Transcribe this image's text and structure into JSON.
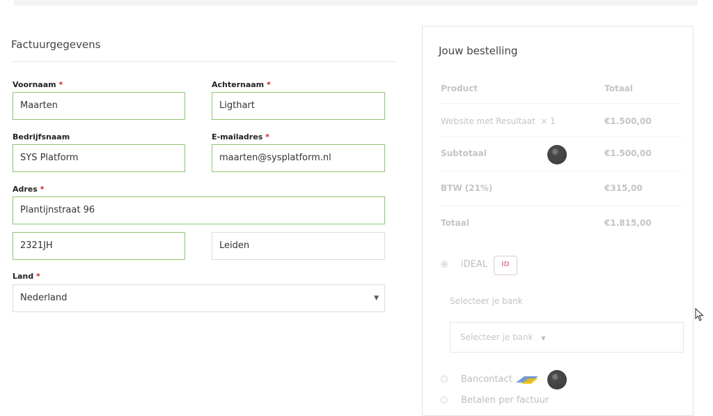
{
  "billing": {
    "title": "Factuurgegevens",
    "required_mark": "*",
    "fields": {
      "first_name": {
        "label": "Voornaam",
        "value": "Maarten"
      },
      "last_name": {
        "label": "Achternaam",
        "value": "Ligthart"
      },
      "company": {
        "label": "Bedrijfsnaam",
        "value": "SYS Platform"
      },
      "email": {
        "label": "E-mailadres",
        "value": "maarten@sysplatform.nl"
      },
      "address": {
        "label": "Adres",
        "value": "Plantijnstraat 96"
      },
      "postcode": {
        "value": "2321JH"
      },
      "city": {
        "value": "Leiden"
      },
      "country": {
        "label": "Land",
        "value": "Nederland"
      }
    }
  },
  "order": {
    "title": "Jouw bestelling",
    "header_product": "Product",
    "header_total": "Totaal",
    "item_name": "Website met Resultaat",
    "item_qty": "× 1",
    "item_price": "€1.500,00",
    "subtotal_label": "Subtotaal",
    "subtotal_value": "€1.500,00",
    "vat_label": "BTW (21%)",
    "vat_value": "€315,00",
    "total_label": "Totaal",
    "total_value": "€1.815,00"
  },
  "payment": {
    "ideal_label": "iDEAL",
    "ideal_logo_text": "iD",
    "bank_label": "Selecteer je bank",
    "bank_select_value": "Selecteer je bank",
    "bank_select_caret": "▼",
    "bancontact_label": "Bancontact",
    "invoice_label": "Betalen per factuur"
  },
  "colors": {
    "valid_border": "#8cc66d",
    "ideal_pink": "#e58cb1",
    "bancontact_blue": "#3a6fb5",
    "bancontact_yellow": "#f3c300"
  }
}
